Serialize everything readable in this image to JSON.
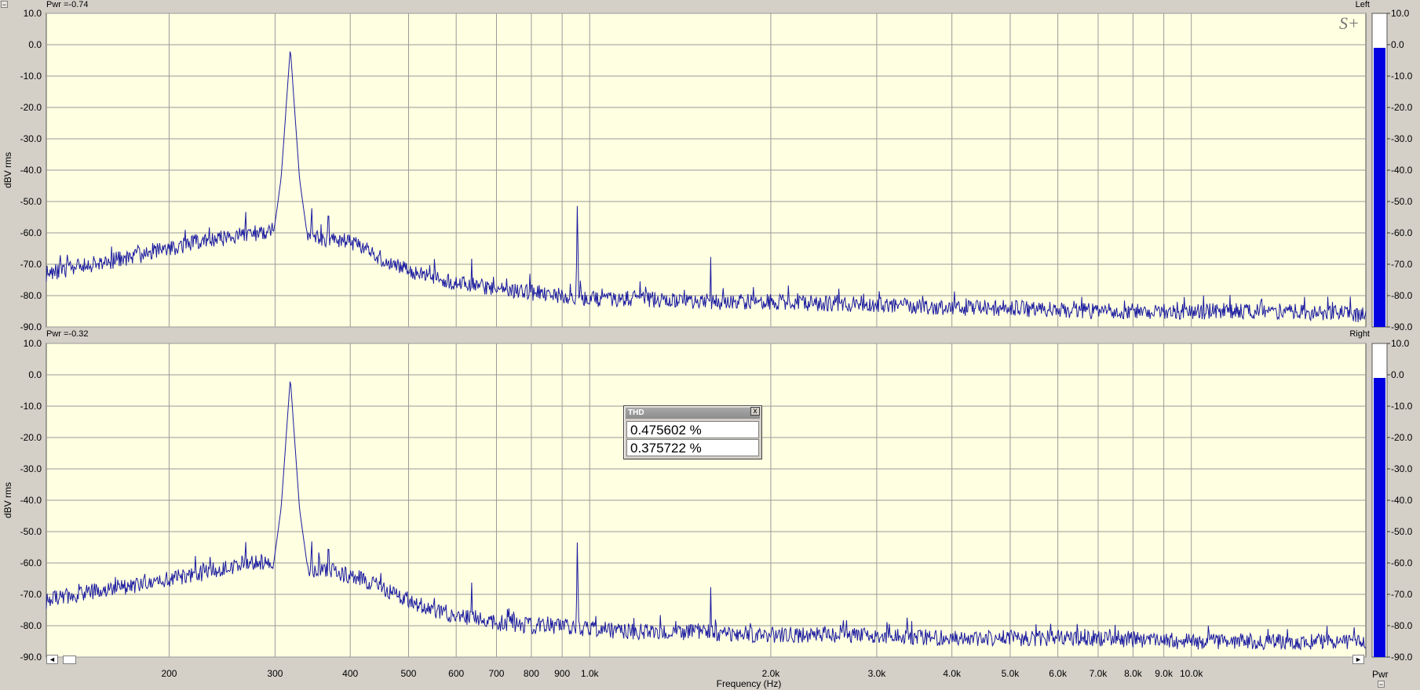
{
  "window": {
    "collapse_glyph": "−",
    "channels": [
      {
        "name": "Left",
        "pwr_label": "Pwr =-0.74",
        "meter_db": -1.0
      },
      {
        "name": "Right",
        "pwr_label": "Pwr =-0.32",
        "meter_db": -1.0
      }
    ],
    "meter_label": "Pwr",
    "logo": "S+",
    "scroll_left": "◄",
    "scroll_right": "►"
  },
  "thd_popup": {
    "title": "THD",
    "close": "x",
    "values": [
      "0.475602 %",
      "0.375722 %"
    ]
  },
  "chart_data": [
    {
      "type": "line",
      "title": "Left",
      "ylabel": "dBV rms",
      "xlabel": "",
      "xscale": "log",
      "xlim": [
        125,
        19500
      ],
      "ylim": [
        -90,
        10
      ],
      "grid": true,
      "y_ticks": [
        "10.0",
        "0.0",
        "-10.0",
        "-20.0",
        "-30.0",
        "-40.0",
        "-50.0",
        "-60.0",
        "-70.0",
        "-80.0",
        "-90.0"
      ],
      "color": "#1a1aa0",
      "noise_seed": 11,
      "noise_amp": 2.6,
      "series": [
        {
          "x": [
            125,
            140,
            160,
            180,
            200,
            220,
            240,
            260,
            280,
            300,
            310,
            320,
            330,
            340,
            360,
            380,
            400,
            430,
            460,
            500,
            550,
            600,
            650,
            700,
            800,
            900,
            1000,
            1200,
            1500,
            2000,
            3000,
            4000,
            5000,
            7000,
            10000,
            14000,
            19500
          ],
          "values": [
            -73,
            -71,
            -69,
            -67,
            -65,
            -63,
            -62,
            -61,
            -60,
            -59,
            -60,
            -61,
            -61,
            -61,
            -62,
            -62,
            -63,
            -66,
            -69,
            -72,
            -74,
            -76,
            -77,
            -78,
            -79,
            -80,
            -81,
            -81,
            -82,
            -82,
            -83,
            -84,
            -84,
            -85,
            -85,
            -85,
            -86
          ]
        }
      ],
      "peaks": [
        {
          "x": 318,
          "y": -1,
          "w": 0.022,
          "skirt": 8
        },
        {
          "x": 636,
          "y": -60,
          "w": 0.003
        },
        {
          "x": 954,
          "y": -48,
          "w": 0.004
        },
        {
          "x": 1590,
          "y": -64,
          "w": 0.003
        }
      ],
      "spurs": [
        {
          "x": 268,
          "y": -51
        },
        {
          "x": 285,
          "y": -54
        },
        {
          "x": 292,
          "y": -55
        },
        {
          "x": 300,
          "y": -56
        },
        {
          "x": 345,
          "y": -50
        },
        {
          "x": 352,
          "y": -55
        },
        {
          "x": 368,
          "y": -50
        },
        {
          "x": 220,
          "y": -58
        },
        {
          "x": 760,
          "y": -78
        },
        {
          "x": 820,
          "y": -77
        },
        {
          "x": 910,
          "y": -78
        }
      ]
    },
    {
      "type": "line",
      "title": "Right",
      "ylabel": "dBV rms",
      "xlabel": "Frequency (Hz)",
      "xscale": "log",
      "xlim": [
        125,
        19500
      ],
      "ylim": [
        -90,
        10
      ],
      "grid": true,
      "y_ticks": [
        "10.0",
        "0.0",
        "-10.0",
        "-20.0",
        "-30.0",
        "-40.0",
        "-50.0",
        "-60.0",
        "-70.0",
        "-80.0",
        "-90.0"
      ],
      "x_ticks": [
        {
          "x": 200,
          "label": "200"
        },
        {
          "x": 300,
          "label": "300"
        },
        {
          "x": 400,
          "label": "400"
        },
        {
          "x": 500,
          "label": "500"
        },
        {
          "x": 600,
          "label": "600"
        },
        {
          "x": 700,
          "label": "700"
        },
        {
          "x": 800,
          "label": "800"
        },
        {
          "x": 900,
          "label": "900"
        },
        {
          "x": 1000,
          "label": "1.0k"
        },
        {
          "x": 2000,
          "label": "2.0k"
        },
        {
          "x": 3000,
          "label": "3.0k"
        },
        {
          "x": 4000,
          "label": "4.0k"
        },
        {
          "x": 5000,
          "label": "5.0k"
        },
        {
          "x": 6000,
          "label": "6.0k"
        },
        {
          "x": 7000,
          "label": "7.0k"
        },
        {
          "x": 8000,
          "label": "8.0k"
        },
        {
          "x": 9000,
          "label": "9.0k"
        },
        {
          "x": 10000,
          "label": "10.0k"
        }
      ],
      "color": "#1a1aa0",
      "noise_seed": 29,
      "noise_amp": 2.6,
      "series": [
        {
          "x": [
            125,
            140,
            160,
            180,
            200,
            220,
            240,
            260,
            280,
            300,
            310,
            320,
            330,
            340,
            360,
            380,
            400,
            430,
            460,
            500,
            550,
            600,
            650,
            700,
            800,
            900,
            1000,
            1200,
            1500,
            2000,
            3000,
            4000,
            5000,
            7000,
            10000,
            14000,
            19500
          ],
          "values": [
            -72,
            -70,
            -68,
            -67,
            -65,
            -64,
            -62,
            -61,
            -60,
            -60,
            -60,
            -61,
            -61,
            -62,
            -62,
            -63,
            -64,
            -66,
            -69,
            -72,
            -75,
            -77,
            -78,
            -79,
            -80,
            -80,
            -81,
            -82,
            -82,
            -83,
            -83,
            -84,
            -84,
            -84,
            -85,
            -85,
            -85
          ]
        }
      ],
      "peaks": [
        {
          "x": 318,
          "y": -1,
          "w": 0.022,
          "skirt": 8
        },
        {
          "x": 636,
          "y": -58,
          "w": 0.003
        },
        {
          "x": 954,
          "y": -50,
          "w": 0.004
        },
        {
          "x": 1590,
          "y": -64,
          "w": 0.003
        }
      ],
      "spurs": [
        {
          "x": 268,
          "y": -51
        },
        {
          "x": 285,
          "y": -53
        },
        {
          "x": 292,
          "y": -55
        },
        {
          "x": 300,
          "y": -56
        },
        {
          "x": 345,
          "y": -51
        },
        {
          "x": 355,
          "y": -53
        },
        {
          "x": 368,
          "y": -51
        },
        {
          "x": 230,
          "y": -60
        },
        {
          "x": 760,
          "y": -77
        },
        {
          "x": 820,
          "y": -78
        },
        {
          "x": 1850,
          "y": -78
        }
      ]
    }
  ]
}
